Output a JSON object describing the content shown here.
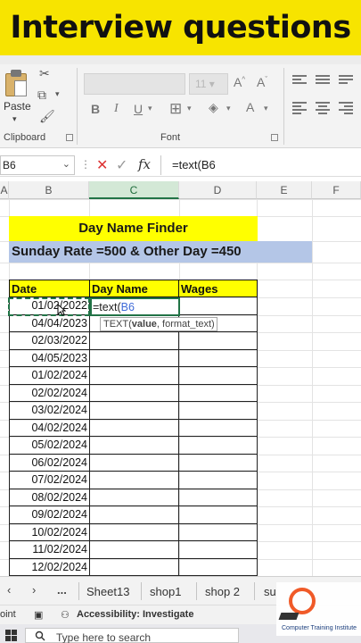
{
  "banner": {
    "title": "Interview questions"
  },
  "ribbon": {
    "paste_label": "Paste",
    "clipboard_label": "Clipboard",
    "font_label": "Font",
    "font_size": "11",
    "bold_label": "B",
    "italic_label": "I",
    "underline_label": "U"
  },
  "formula_bar": {
    "name_box": "B6",
    "formula": "=text(B6"
  },
  "columns": [
    "A",
    "B",
    "C",
    "D",
    "E",
    "F"
  ],
  "sheet": {
    "title": "Day Name Finder",
    "subtitle": "Sunday Rate =500 & Other Day =450",
    "headers": [
      "Date",
      "Day Name",
      "Wages"
    ],
    "editing_text": "=text(",
    "editing_ref": "B6",
    "tooltip_fn": "TEXT(",
    "tooltip_arg1": "value",
    "tooltip_rest": ", format_text)",
    "dates": [
      "01/02/2022",
      "04/04/2023",
      "02/03/2022",
      "04/05/2023",
      "01/02/2024",
      "02/02/2024",
      "03/02/2024",
      "04/02/2024",
      "05/02/2024",
      "06/02/2024",
      "07/02/2024",
      "08/02/2024",
      "09/02/2024",
      "10/02/2024",
      "11/02/2024",
      "12/02/2024"
    ]
  },
  "tabs": {
    "more": "...",
    "items": [
      "Sheet13",
      "shop1",
      "shop 2",
      "su"
    ]
  },
  "status": {
    "mode": "oint",
    "accessibility": "Accessibility: Investigate"
  },
  "taskbar": {
    "search_placeholder": "Type here to search"
  },
  "logo": {
    "text": "Computer Training Institute"
  },
  "colors": {
    "excel_green": "#217346",
    "yellow": "#ffff00",
    "blue_band": "#b4c6e7",
    "banner": "#f7e400"
  }
}
